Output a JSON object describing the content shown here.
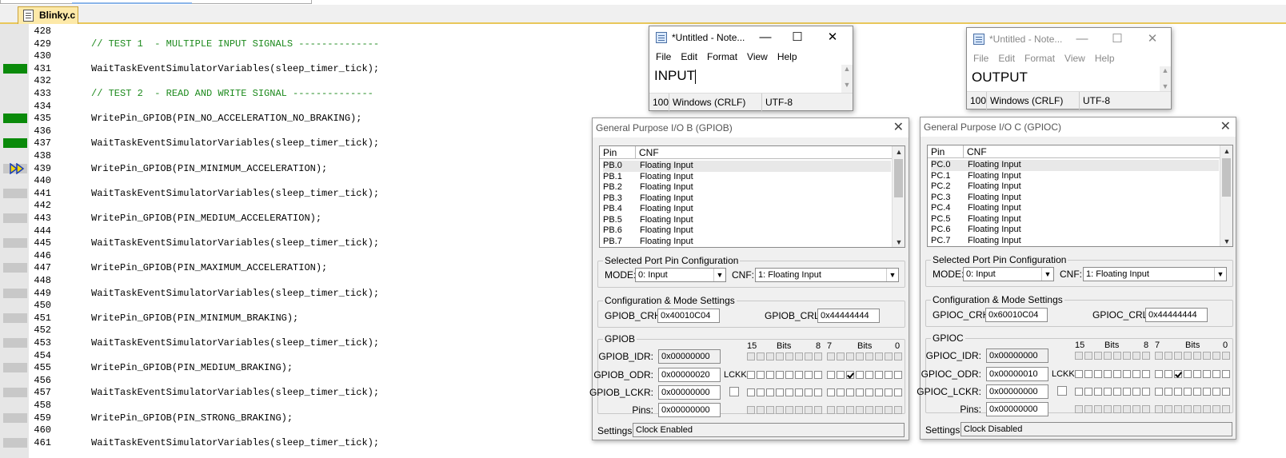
{
  "tab": {
    "file_name": "Blinky.c"
  },
  "editor": {
    "lines": [
      {
        "num": "428",
        "text": "",
        "mark": "none"
      },
      {
        "num": "429",
        "text": "// TEST 1  - MULTIPLE INPUT SIGNALS --------------",
        "mark": "none",
        "comment": true
      },
      {
        "num": "430",
        "text": "",
        "mark": "none"
      },
      {
        "num": "431",
        "text": "WaitTaskEventSimulatorVariables(sleep_timer_tick);",
        "mark": "exec"
      },
      {
        "num": "432",
        "text": "",
        "mark": "none"
      },
      {
        "num": "433",
        "text": "// TEST 2  - READ AND WRITE SIGNAL --------------",
        "mark": "none",
        "comment": true
      },
      {
        "num": "434",
        "text": "",
        "mark": "none"
      },
      {
        "num": "435",
        "text": "WritePin_GPIOB(PIN_NO_ACCELERATION_NO_BRAKING);",
        "mark": "exec"
      },
      {
        "num": "436",
        "text": "",
        "mark": "none"
      },
      {
        "num": "437",
        "text": "WaitTaskEventSimulatorVariables(sleep_timer_tick);",
        "mark": "exec"
      },
      {
        "num": "438",
        "text": "",
        "mark": "none"
      },
      {
        "num": "439",
        "text": "WritePin_GPIOB(PIN_MINIMUM_ACCELERATION);",
        "mark": "current"
      },
      {
        "num": "440",
        "text": "",
        "mark": "none"
      },
      {
        "num": "441",
        "text": "WaitTaskEventSimulatorVariables(sleep_timer_tick);",
        "mark": "code"
      },
      {
        "num": "442",
        "text": "",
        "mark": "none"
      },
      {
        "num": "443",
        "text": "WritePin_GPIOB(PIN_MEDIUM_ACCELERATION);",
        "mark": "code"
      },
      {
        "num": "444",
        "text": "",
        "mark": "none"
      },
      {
        "num": "445",
        "text": "WaitTaskEventSimulatorVariables(sleep_timer_tick);",
        "mark": "code"
      },
      {
        "num": "446",
        "text": "",
        "mark": "none"
      },
      {
        "num": "447",
        "text": "WritePin_GPIOB(PIN_MAXIMUM_ACCELERATION);",
        "mark": "code"
      },
      {
        "num": "448",
        "text": "",
        "mark": "none"
      },
      {
        "num": "449",
        "text": "WaitTaskEventSimulatorVariables(sleep_timer_tick);",
        "mark": "code"
      },
      {
        "num": "450",
        "text": "",
        "mark": "none"
      },
      {
        "num": "451",
        "text": "WritePin_GPIOB(PIN_MINIMUM_BRAKING);",
        "mark": "code"
      },
      {
        "num": "452",
        "text": "",
        "mark": "none"
      },
      {
        "num": "453",
        "text": "WaitTaskEventSimulatorVariables(sleep_timer_tick);",
        "mark": "code"
      },
      {
        "num": "454",
        "text": "",
        "mark": "none"
      },
      {
        "num": "455",
        "text": "WritePin_GPIOB(PIN_MEDIUM_BRAKING);",
        "mark": "code"
      },
      {
        "num": "456",
        "text": "",
        "mark": "none"
      },
      {
        "num": "457",
        "text": "WaitTaskEventSimulatorVariables(sleep_timer_tick);",
        "mark": "code"
      },
      {
        "num": "458",
        "text": "",
        "mark": "none"
      },
      {
        "num": "459",
        "text": "WritePin_GPIOB(PIN_STRONG_BRAKING);",
        "mark": "code"
      },
      {
        "num": "460",
        "text": "",
        "mark": "none"
      },
      {
        "num": "461",
        "text": "WaitTaskEventSimulatorVariables(sleep_timer_tick);",
        "mark": "code"
      }
    ]
  },
  "notepad_input": {
    "title": "*Untitled - Note...",
    "menu": [
      "File",
      "Edit",
      "Format",
      "View",
      "Help"
    ],
    "content": "INPUT",
    "status": {
      "zoom": "100",
      "eol": "Windows (CRLF)",
      "encoding": "UTF-8"
    }
  },
  "notepad_output": {
    "title": "*Untitled - Note...",
    "menu": [
      "File",
      "Edit",
      "Format",
      "View",
      "Help"
    ],
    "content": "OUTPUT",
    "status": {
      "zoom": "100",
      "eol": "Windows (CRLF)",
      "encoding": "UTF-8"
    }
  },
  "gpiob": {
    "title": "General Purpose I/O B (GPIOB)",
    "col_pin": "Pin",
    "col_cnf": "CNF",
    "pins": [
      {
        "pin": "PB.0",
        "cnf": "Floating Input"
      },
      {
        "pin": "PB.1",
        "cnf": "Floating Input"
      },
      {
        "pin": "PB.2",
        "cnf": "Floating Input"
      },
      {
        "pin": "PB.3",
        "cnf": "Floating Input"
      },
      {
        "pin": "PB.4",
        "cnf": "Floating Input"
      },
      {
        "pin": "PB.5",
        "cnf": "Floating Input"
      },
      {
        "pin": "PB.6",
        "cnf": "Floating Input"
      },
      {
        "pin": "PB.7",
        "cnf": "Floating Input"
      }
    ],
    "sel_group": "Selected Port Pin Configuration",
    "mode_label": "MODE:",
    "mode_value": "0: Input",
    "cnf_label": "CNF:",
    "cnf_value": "1: Floating Input",
    "cfg_group": "Configuration & Mode Settings",
    "crh_label": "GPIOB_CRH:",
    "crh_value": "0x40010C04",
    "crl_label": "GPIOB_CRL:",
    "crl_value": "0x44444444",
    "reg_group": "GPIOB",
    "idr_label": "GPIOB_IDR:",
    "idr_value": "0x00000000",
    "odr_label": "GPIOB_ODR:",
    "odr_value": "0x00000020",
    "lckr_label": "GPIOB_LCKR:",
    "lckr_value": "0x00000000",
    "pins_label": "Pins:",
    "pins_value": "0x00000000",
    "lckk": "LCKK",
    "bits_hi": "15",
    "bits_word": "Bits",
    "bits_8": "8",
    "bits_7": "7",
    "bits_0": "0",
    "odr_checked_bit": 5,
    "settings_label": "Settings:",
    "settings_value": "Clock Enabled"
  },
  "gpioc": {
    "title": "General Purpose I/O C (GPIOC)",
    "col_pin": "Pin",
    "col_cnf": "CNF",
    "pins": [
      {
        "pin": "PC.0",
        "cnf": "Floating Input"
      },
      {
        "pin": "PC.1",
        "cnf": "Floating Input"
      },
      {
        "pin": "PC.2",
        "cnf": "Floating Input"
      },
      {
        "pin": "PC.3",
        "cnf": "Floating Input"
      },
      {
        "pin": "PC.4",
        "cnf": "Floating Input"
      },
      {
        "pin": "PC.5",
        "cnf": "Floating Input"
      },
      {
        "pin": "PC.6",
        "cnf": "Floating Input"
      },
      {
        "pin": "PC.7",
        "cnf": "Floating Input"
      }
    ],
    "sel_group": "Selected Port Pin Configuration",
    "mode_label": "MODE:",
    "mode_value": "0: Input",
    "cnf_label": "CNF:",
    "cnf_value": "1: Floating Input",
    "cfg_group": "Configuration & Mode Settings",
    "crh_label": "GPIOC_CRH:",
    "crh_value": "0x60010C04",
    "crl_label": "GPIOC_CRL:",
    "crl_value": "0x44444444",
    "reg_group": "GPIOC",
    "idr_label": "GPIOC_IDR:",
    "idr_value": "0x00000000",
    "odr_label": "GPIOC_ODR:",
    "odr_value": "0x00000010",
    "lckr_label": "GPIOC_LCKR:",
    "lckr_value": "0x00000000",
    "pins_label": "Pins:",
    "pins_value": "0x00000000",
    "lckk": "LCKK",
    "bits_hi": "15",
    "bits_word": "Bits",
    "bits_8": "8",
    "bits_7": "7",
    "bits_0": "0",
    "odr_checked_bit": 5,
    "settings_label": "Settings:",
    "settings_value": "Clock Disabled"
  },
  "colors": {
    "exec_mark": "#0a8a0a",
    "comment": "#1d8a1d",
    "tab_active": "#fde9a8"
  }
}
